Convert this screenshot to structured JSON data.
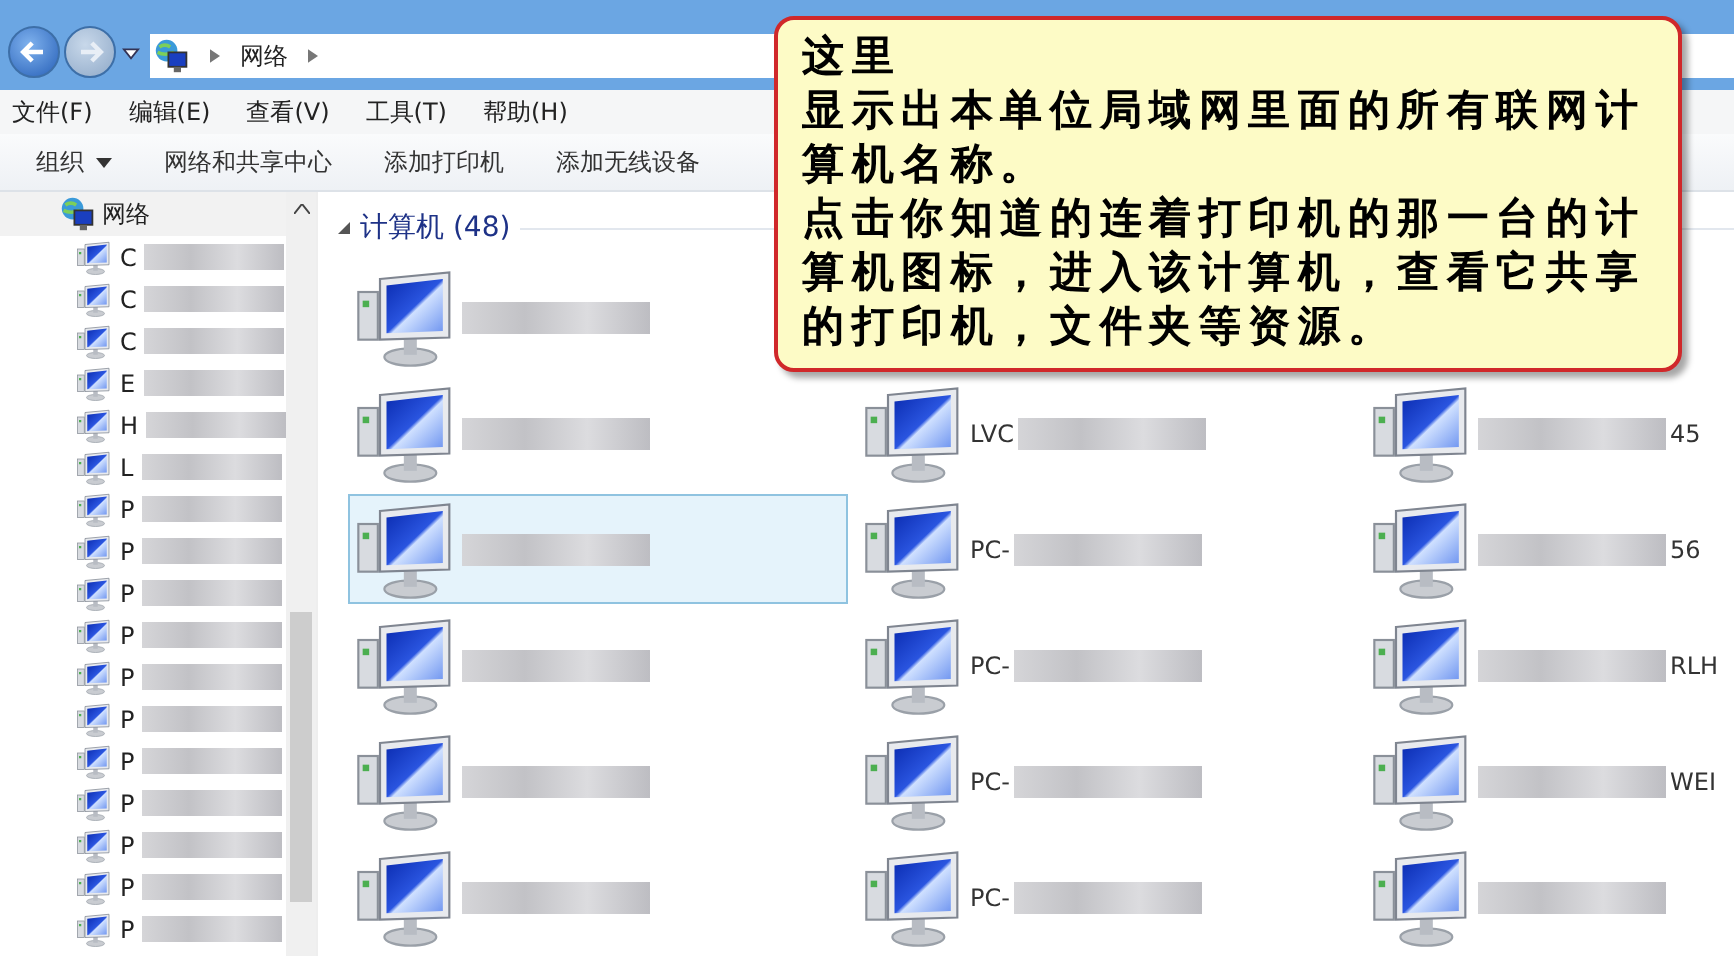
{
  "address_bar": {
    "path": "网络"
  },
  "menu": [
    "文件(F)",
    "编辑(E)",
    "查看(V)",
    "工具(T)",
    "帮助(H)"
  ],
  "toolbar": [
    {
      "label": "组织",
      "dropdown": true
    },
    {
      "label": "网络和共享中心",
      "dropdown": false
    },
    {
      "label": "添加打印机",
      "dropdown": false
    },
    {
      "label": "添加无线设备",
      "dropdown": false
    }
  ],
  "nav": {
    "label": "网络",
    "children": [
      {
        "prefix": "C"
      },
      {
        "prefix": "C"
      },
      {
        "prefix": "C"
      },
      {
        "prefix": "E"
      },
      {
        "prefix": "H"
      },
      {
        "prefix": "L"
      },
      {
        "prefix": "P"
      },
      {
        "prefix": "P"
      },
      {
        "prefix": "P"
      },
      {
        "prefix": "P"
      },
      {
        "prefix": "P"
      },
      {
        "prefix": "P"
      },
      {
        "prefix": "P"
      },
      {
        "prefix": "P"
      },
      {
        "prefix": "P"
      },
      {
        "prefix": "P"
      },
      {
        "prefix": "P"
      }
    ]
  },
  "group": {
    "title": "计算机 (48)",
    "expanded": true
  },
  "rows": [
    [
      {
        "selected": false,
        "blurred": true
      }
    ],
    [
      {
        "selected": false,
        "blurred": true
      },
      {
        "prefix": "LVC",
        "selected": false,
        "blurred": true
      },
      {
        "suffix": "45",
        "selected": false,
        "blurred": true
      }
    ],
    [
      {
        "selected": true,
        "blurred": true
      },
      {
        "prefix": "PC-",
        "selected": false,
        "blurred": true
      },
      {
        "suffix": "56",
        "selected": false,
        "blurred": true
      }
    ],
    [
      {
        "selected": false,
        "blurred": true
      },
      {
        "prefix": "PC-",
        "selected": false,
        "blurred": true
      },
      {
        "suffix": "RLH",
        "selected": false,
        "blurred": true
      }
    ],
    [
      {
        "selected": false,
        "blurred": true
      },
      {
        "prefix": "PC-",
        "selected": false,
        "blurred": true
      },
      {
        "suffix": "WEI",
        "selected": false,
        "blurred": true
      }
    ],
    [
      {
        "selected": false,
        "blurred": true
      },
      {
        "prefix": "PC-",
        "selected": false,
        "blurred": true
      },
      {
        "selected": false,
        "blurred": true
      }
    ]
  ],
  "callout": {
    "paragraphs": [
      "这里",
      "显示出本单位局域网里面的所有联网计算机名称。",
      "点击你知道的连着打印机的那一台的计算机图标，进入该计算机，查看它共享的打印机，文件夹等资源。"
    ]
  }
}
